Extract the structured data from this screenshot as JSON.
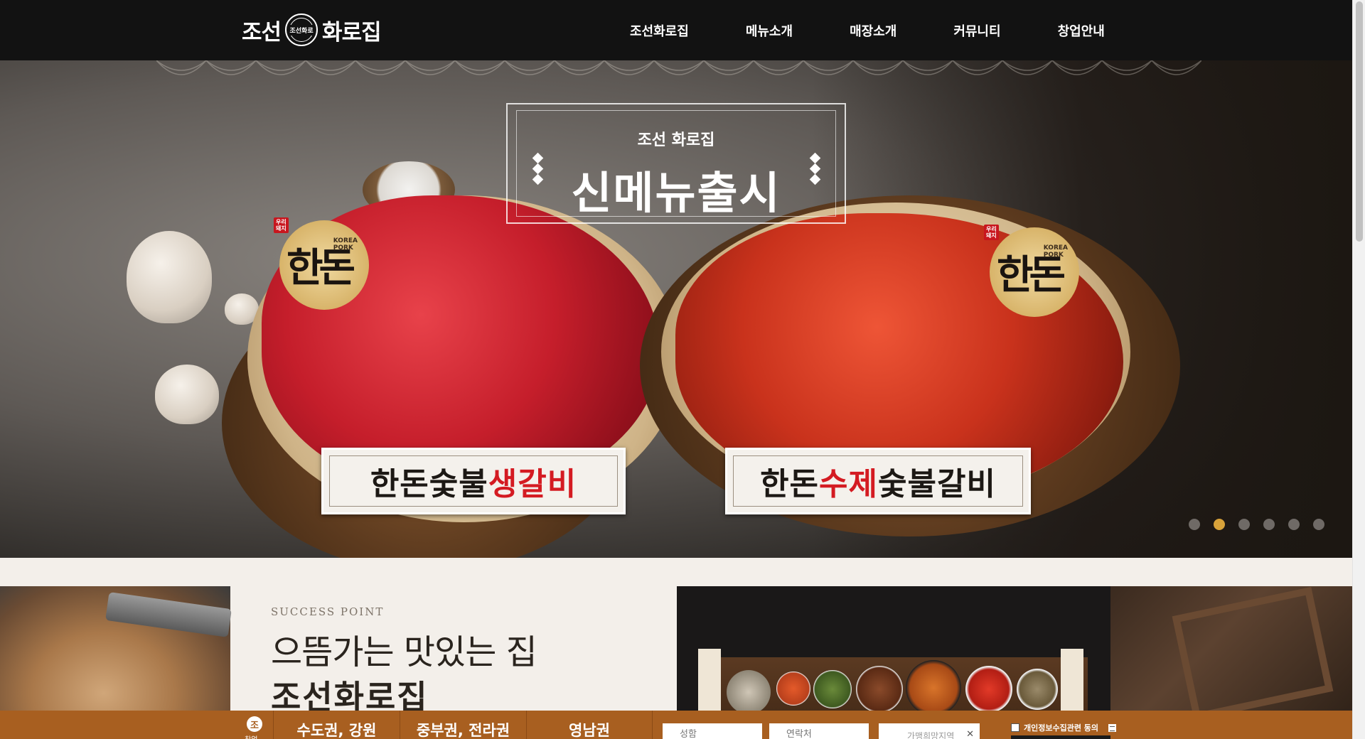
{
  "header": {
    "logo": {
      "left_word": "조선",
      "seal_text": "조선화로",
      "right_word": "화로집"
    },
    "nav": [
      "조선화로집",
      "메뉴소개",
      "매장소개",
      "커뮤니티",
      "창업안내"
    ]
  },
  "hero": {
    "mini_logo": "조선 화로집",
    "headline": "신메뉴출시",
    "badge": {
      "main": "한돈",
      "sub_line1": "KOREA",
      "sub_line2": "PORK",
      "tag_line1": "우리",
      "tag_line2": "돼지"
    },
    "cards": [
      {
        "prefix": "한돈숯불",
        "highlight": "생갈비",
        "suffix": ""
      },
      {
        "prefix": "한돈",
        "highlight": "수제",
        "suffix": "숯불갈비"
      }
    ],
    "slides_total": 6,
    "active_slide": 2
  },
  "section2": {
    "eyebrow": "SUCCESS POINT",
    "title": "으뜸가는 맛있는 집",
    "brand": "조선화로집"
  },
  "inquiry": {
    "icon_sub": "창업",
    "regions": [
      "수도권, 강원",
      "중부권, 전라권",
      "영남권"
    ],
    "name_placeholder": "성함",
    "phone_placeholder": "연락처",
    "area_placeholder": "가맹희망지역",
    "agree_label": "개인정보수집관련 동의"
  },
  "colors": {
    "header_bg": "#121212",
    "accent_gold": "#d8a23a",
    "bar_brown": "#a85f20",
    "highlight_red": "#d41b22"
  }
}
